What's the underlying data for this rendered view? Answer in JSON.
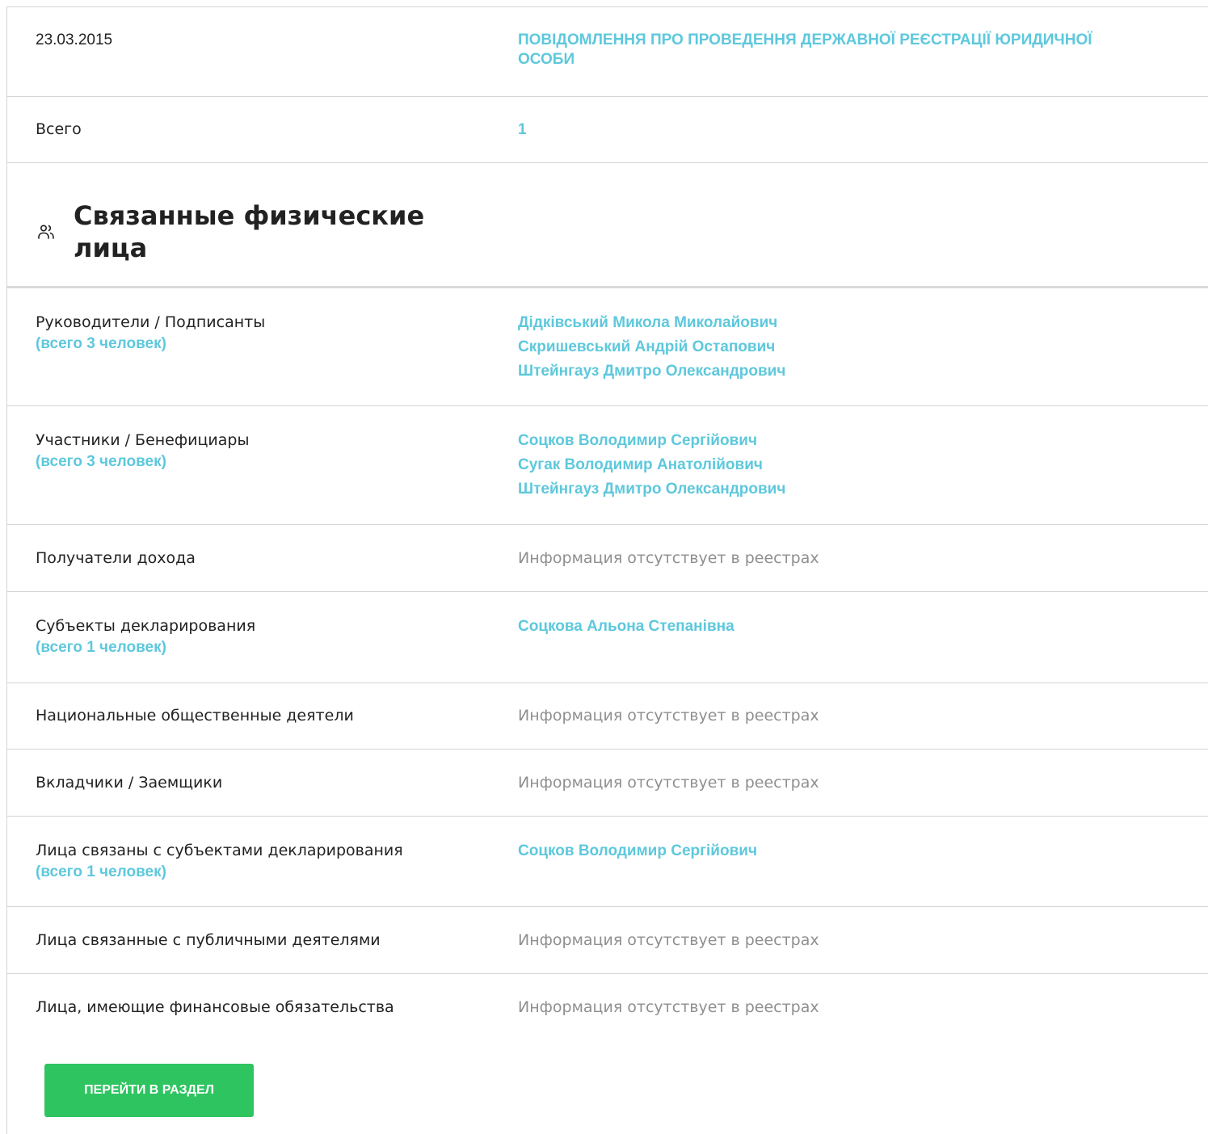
{
  "header": {
    "date": "23.03.2015",
    "notice": "ПОВІДОМЛЕННЯ ПРО ПРОВЕДЕННЯ ДЕРЖАВНОЇ РЕЄСТРАЦІЇ ЮРИДИЧНОЇ ОСОБИ",
    "total_label": "Всего",
    "total_value": "1"
  },
  "section": {
    "icon": "people-icon",
    "title": "Связанные физические лица"
  },
  "rows": [
    {
      "label": "Руководители / Подписанты",
      "count": "(всего 3 человек)",
      "names": [
        "Дідківський Микола Миколайович",
        "Скришевський Андрій Остапович",
        "Штейнгауз Дмитро Олександрович"
      ]
    },
    {
      "label": "Участники / Бенефициары",
      "count": "(всего 3 человек)",
      "names": [
        "Соцков Володимир Сергійович",
        "Сугак Володимир Анатолійович",
        "Штейнгауз Дмитро Олександрович"
      ]
    },
    {
      "label": "Получатели дохода",
      "empty": "Информация отсутствует в реестрах"
    },
    {
      "label": "Субъекты декларирования",
      "count": "(всего 1 человек)",
      "names": [
        "Соцкова Альона Степанівна"
      ]
    },
    {
      "label": "Национальные общественные деятели",
      "empty": "Информация отсутствует в реестрах"
    },
    {
      "label": "Вкладчики / Заемщики",
      "empty": "Информация отсутствует в реестрах"
    },
    {
      "label": "Лица связаны с субъектами декларирования",
      "count": "(всего 1 человек)",
      "names": [
        "Соцков Володимир Сергійович"
      ]
    },
    {
      "label": "Лица связанные с публичными деятелями",
      "empty": "Информация отсутствует в реестрах"
    },
    {
      "label": "Лица, имеющие финансовые обязательства",
      "empty": "Информация отсутствует в реестрах"
    }
  ],
  "button": {
    "label": "ПЕРЕЙТИ В РАЗДЕЛ"
  },
  "colors": {
    "link": "#5ec8dc",
    "button": "#2ec460",
    "muted": "#8f8f8f"
  }
}
